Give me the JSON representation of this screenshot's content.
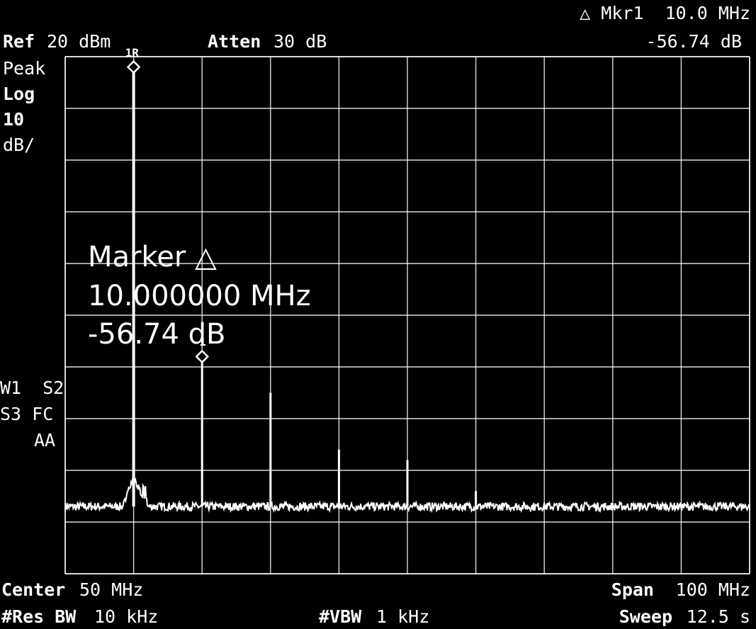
{
  "header": {
    "ref_label": "Ref",
    "ref_value": "20 dBm",
    "atten_label": "Atten",
    "atten_value": "30 dB",
    "mkr_line1": "△ Mkr1  10.0 MHz",
    "mkr_line2": "-56.74 dB"
  },
  "left_panel": {
    "detector": "Peak",
    "scale_type": "Log",
    "scale_value": "10",
    "scale_unit": "dB/",
    "trace_status_1": "W1  S2",
    "trace_status_2": "S3 FC",
    "trace_status_3": "AA"
  },
  "marker_box": {
    "title": "Marker △",
    "frequency": "10.000000 MHz",
    "amplitude": "-56.74 dB"
  },
  "marker_labels": {
    "ref": "1R",
    "delta": "1"
  },
  "footer": {
    "center_label": "Center",
    "center_value": "50 MHz",
    "span_label": "Span",
    "span_value": "100 MHz",
    "resbw_label": "#Res BW",
    "resbw_value": "10 kHz",
    "vbw_label": "#VBW",
    "vbw_value": "1 kHz",
    "sweep_label": "Sweep",
    "sweep_value": "12.5 s"
  },
  "colors": {
    "background": "#000000",
    "trace": "#ffffff",
    "grid": "#ffffff"
  },
  "chart_data": {
    "type": "line",
    "x_unit": "MHz",
    "y_unit": "dBm",
    "xlim": [
      0,
      100
    ],
    "ylim": [
      -80,
      20
    ],
    "x_divisions": 10,
    "y_divisions": 10,
    "grid": true,
    "noise_floor_dbm": -67,
    "spurs": [
      {
        "x": 10,
        "y": 18
      },
      {
        "x": 20,
        "y": -38
      },
      {
        "x": 30,
        "y": -45
      },
      {
        "x": 40,
        "y": -56
      },
      {
        "x": 50,
        "y": -58
      },
      {
        "x": 60,
        "y": -64
      }
    ],
    "markers": [
      {
        "name": "1R",
        "x": 10,
        "y": 18
      },
      {
        "name": "1",
        "x": 20,
        "y": -38
      }
    ]
  }
}
